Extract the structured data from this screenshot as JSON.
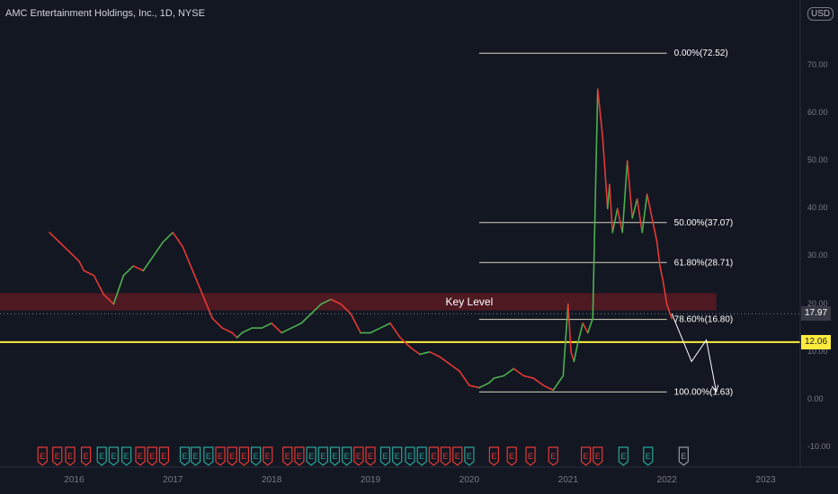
{
  "header": {
    "title": "AMC Entertainment Holdings, Inc., 1D, NYSE",
    "currency": "USD"
  },
  "colors": {
    "background": "#131722",
    "up": "#4caf50",
    "down": "#e53935",
    "key_level_zone": "#5b1a22",
    "fib_line": "#d7d7c0",
    "support_line": "#ffeb3b",
    "arrow": "#ffffff",
    "earnings_red": "#e53935",
    "earnings_green": "#26a69a",
    "earnings_gray": "#9598a1"
  },
  "price_labels": {
    "current": "17.97",
    "support": "12.06"
  },
  "chart_data": {
    "type": "line",
    "title": "AMC Entertainment Holdings, Inc., 1D, NYSE",
    "xlabel": "",
    "ylabel": "",
    "ylim": [
      -14,
      82
    ],
    "y_ticks": [
      "-10.00",
      "0.00",
      "10.00",
      "20.00",
      "30.00",
      "40.00",
      "50.00",
      "60.00",
      "70.00"
    ],
    "x_ticks": [
      "2016",
      "2017",
      "2018",
      "2019",
      "2020",
      "2021",
      "2022",
      "2023"
    ],
    "series": [
      {
        "x": [
          2015.75,
          2015.85,
          2015.95,
          2016.05,
          2016.1,
          2016.2,
          2016.3,
          2016.4,
          2016.5,
          2016.6,
          2016.7,
          2016.8,
          2016.9,
          2017.0,
          2017.1,
          2017.2,
          2017.3,
          2017.4,
          2017.5,
          2017.6,
          2017.65,
          2017.7,
          2017.8,
          2017.9,
          2018.0,
          2018.1,
          2018.2,
          2018.3,
          2018.4,
          2018.5,
          2018.6,
          2018.7,
          2018.8,
          2018.9,
          2019.0,
          2019.1,
          2019.2,
          2019.3,
          2019.4,
          2019.5,
          2019.6,
          2019.7,
          2019.8,
          2019.9,
          2020.0,
          2020.1,
          2020.2,
          2020.25,
          2020.35,
          2020.45,
          2020.55,
          2020.65,
          2020.75,
          2020.85,
          2020.95,
          2021.0,
          2021.03,
          2021.06,
          2021.1,
          2021.15,
          2021.2,
          2021.25,
          2021.3,
          2021.35,
          2021.4,
          2021.42,
          2021.45,
          2021.5,
          2021.55,
          2021.6,
          2021.65,
          2021.7,
          2021.75,
          2021.8,
          2021.85,
          2021.9,
          2021.93,
          2021.96,
          2022.0,
          2022.05
        ],
        "values": [
          35,
          33,
          31,
          29,
          27,
          26,
          22,
          20,
          26,
          28,
          27,
          30,
          33,
          35,
          32,
          27,
          22,
          17,
          15,
          14,
          13,
          14,
          15,
          15,
          16,
          14,
          15,
          16,
          18,
          20,
          21,
          20,
          18,
          14,
          14,
          15,
          16,
          13,
          11,
          9.5,
          10,
          9,
          7.5,
          6,
          3,
          2.5,
          3.5,
          4.5,
          5,
          6.5,
          5,
          4.5,
          3,
          2,
          5,
          20,
          10,
          8,
          12,
          16,
          14,
          17,
          65,
          55,
          40,
          45,
          35,
          40,
          35,
          50,
          38,
          42,
          35,
          43,
          38,
          33,
          28,
          25,
          20,
          17
        ]
      }
    ],
    "fibonacci": [
      {
        "label": "0.00%(72.52)",
        "price": 72.52
      },
      {
        "label": "50.00%(37.07)",
        "price": 37.07
      },
      {
        "label": "61.80%(28.71)",
        "price": 28.71
      },
      {
        "label": "78.60%(16.80)",
        "price": 16.8
      },
      {
        "label": "100.00%(1.63)",
        "price": 1.63
      }
    ],
    "key_level": {
      "label": "Key Level",
      "from": 18.7,
      "to": 22.3
    },
    "support_price": 12.06,
    "current_price": 17.97,
    "projection": [
      {
        "x": 2022.05,
        "y": 18
      },
      {
        "x": 2022.25,
        "y": 8
      },
      {
        "x": 2022.4,
        "y": 12.5
      },
      {
        "x": 2022.5,
        "y": 1.63
      }
    ],
    "earnings": {
      "x": [
        2015.68,
        2015.83,
        2015.96,
        2016.12,
        2016.28,
        2016.4,
        2016.53,
        2016.67,
        2016.79,
        2016.91,
        2017.12,
        2017.23,
        2017.36,
        2017.48,
        2017.6,
        2017.72,
        2017.84,
        2017.96,
        2018.16,
        2018.28,
        2018.4,
        2018.52,
        2018.64,
        2018.76,
        2018.88,
        2019.0,
        2019.15,
        2019.27,
        2019.4,
        2019.52,
        2019.64,
        2019.76,
        2019.88,
        2020.0,
        2020.25,
        2020.43,
        2020.62,
        2020.85,
        2021.18,
        2021.3,
        2021.56,
        2021.81,
        2022.17
      ],
      "labels": [
        "E",
        "E",
        "E",
        "E",
        "E",
        "E",
        "E",
        "E",
        "E",
        "E",
        "E",
        "E",
        "E",
        "E",
        "E",
        "E",
        "E",
        "E",
        "E",
        "E",
        "E",
        "E",
        "E",
        "E",
        "E",
        "E",
        "E",
        "E",
        "E",
        "E",
        "E",
        "E",
        "E",
        "E",
        "E",
        "E",
        "E",
        "E",
        "E",
        "E",
        "E",
        "E",
        "E"
      ],
      "kinds": [
        "red",
        "red",
        "red",
        "red",
        "green",
        "green",
        "green",
        "red",
        "red",
        "red",
        "green",
        "green",
        "green",
        "red",
        "red",
        "red",
        "green",
        "red",
        "red",
        "red",
        "green",
        "green",
        "green",
        "green",
        "red",
        "red",
        "green",
        "green",
        "green",
        "green",
        "red",
        "red",
        "red",
        "green",
        "red",
        "red",
        "red",
        "red",
        "red",
        "red",
        "green",
        "green",
        "gray"
      ]
    }
  }
}
